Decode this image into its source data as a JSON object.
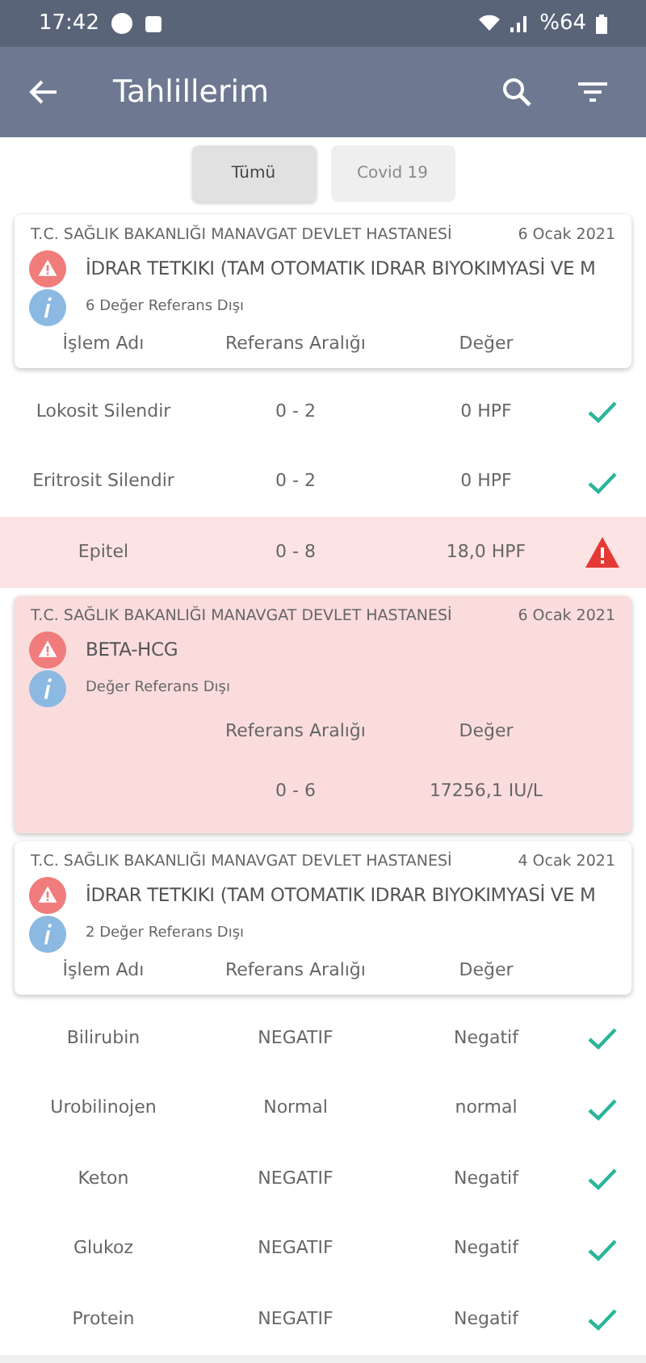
{
  "status_bar": {
    "time": "17:42",
    "battery": "%64"
  },
  "app_bar": {
    "title": "Tahlillerim"
  },
  "filters": [
    {
      "label": "Tümü",
      "selected": true
    },
    {
      "label": "Covid 19",
      "selected": false
    }
  ],
  "sections": [
    {
      "kind": "list",
      "hospital": "T.C. SAĞLIK BAKANLIĞI MANAVGAT DEVLET HASTANESİ",
      "date": "6 Ocak 2021",
      "title": "İDRAR TETKIKI (TAM OTOMATIK IDRAR BIYOKIMYASİ VE M",
      "summary": "6 Değer Referans Dışı",
      "out_of_range": false,
      "columns": [
        "İşlem Adı",
        "Referans Aralığı",
        "Değer"
      ],
      "rows": [
        {
          "name": "Lokosit Silendir",
          "range": "0 - 2",
          "value": "0 HPF",
          "in_range": true
        },
        {
          "name": "Eritrosit Silendir",
          "range": "0 - 2",
          "value": "0 HPF",
          "in_range": true
        },
        {
          "name": "Epitel",
          "range": "0 - 8",
          "value": "18,0 HPF",
          "in_range": false
        }
      ]
    },
    {
      "kind": "single",
      "hospital": "T.C. SAĞLIK BAKANLIĞI MANAVGAT DEVLET HASTANESİ",
      "date": "6 Ocak 2021",
      "title": "BETA-HCG",
      "summary": "Değer Referans Dışı",
      "out_of_range": true,
      "columns": [
        "Referans Aralığı",
        "Değer"
      ],
      "rows": [
        {
          "range": "0 - 6",
          "value": "17256,1 IU/L"
        }
      ]
    },
    {
      "kind": "list",
      "hospital": "T.C. SAĞLIK BAKANLIĞI MANAVGAT DEVLET HASTANESİ",
      "date": "4 Ocak 2021",
      "title": "İDRAR TETKIKI (TAM OTOMATIK IDRAR BIYOKIMYASİ VE M",
      "summary": "2 Değer Referans Dışı",
      "out_of_range": false,
      "columns": [
        "İşlem Adı",
        "Referans Aralığı",
        "Değer"
      ],
      "rows": [
        {
          "name": "Bilirubin",
          "range": "NEGATIF",
          "value": "Negatif",
          "in_range": true
        },
        {
          "name": "Urobilinojen",
          "range": "Normal",
          "value": "normal",
          "in_range": true
        },
        {
          "name": "Keton",
          "range": "NEGATIF",
          "value": "Negatif",
          "in_range": true
        },
        {
          "name": "Glukoz",
          "range": "NEGATIF",
          "value": "Negatif",
          "in_range": true
        },
        {
          "name": "Protein",
          "range": "NEGATIF",
          "value": "Negatif",
          "in_range": true
        }
      ]
    }
  ]
}
